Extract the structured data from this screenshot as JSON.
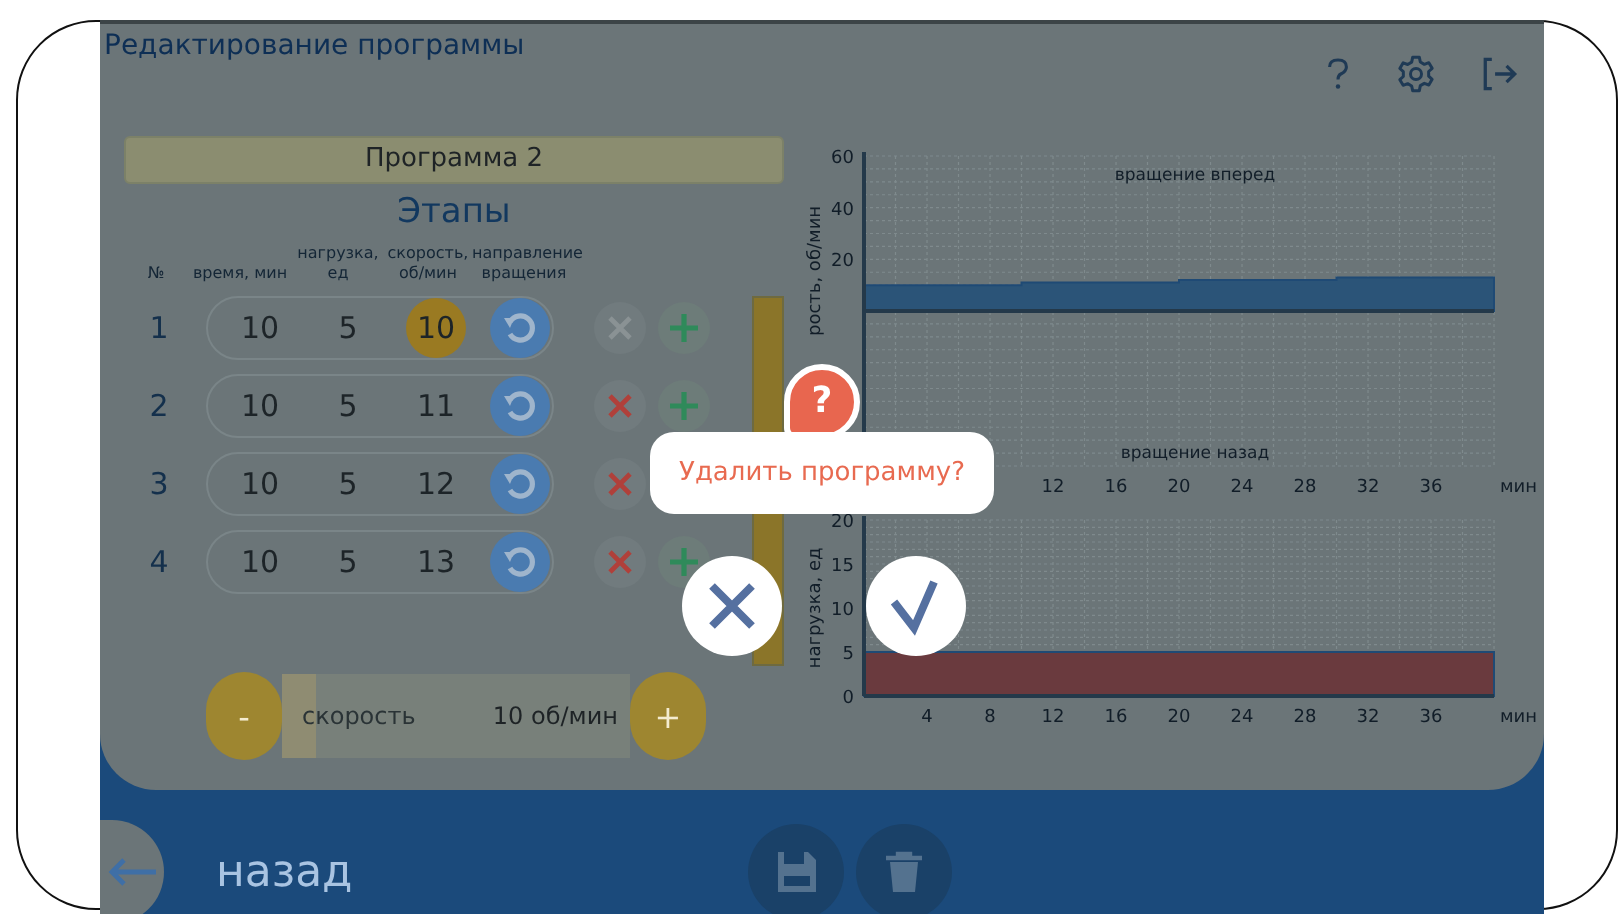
{
  "header": {
    "title": "Редактирование программы"
  },
  "program": {
    "name": "Программа 2"
  },
  "stages": {
    "title": "Этапы",
    "columns": [
      "№",
      "время, мин",
      "нагрузка, ед",
      "скорость, об/мин",
      "направление вращения"
    ],
    "rows": [
      {
        "num": "1",
        "time": "10",
        "load": "5",
        "speed": "10",
        "selected": true,
        "delete_disabled": true
      },
      {
        "num": "2",
        "time": "10",
        "load": "5",
        "speed": "11",
        "selected": false,
        "delete_disabled": false
      },
      {
        "num": "3",
        "time": "10",
        "load": "5",
        "speed": "12",
        "selected": false,
        "delete_disabled": false
      },
      {
        "num": "4",
        "time": "10",
        "load": "5",
        "speed": "13",
        "selected": false,
        "delete_disabled": false
      }
    ]
  },
  "speed_control": {
    "minus": "-",
    "label": "скорость",
    "value": "10 об/мин",
    "plus": "+",
    "level": 0.1
  },
  "charts": [
    {
      "chart_data": {
        "type": "area",
        "grid": true,
        "ylabel": "рость, об/мин",
        "xlabel": "мин",
        "x": [
          0,
          10,
          20,
          30,
          40
        ],
        "series": [
          {
            "color": "#2b5478",
            "values": [
              10,
              11,
              12,
              13,
              13
            ]
          }
        ],
        "xlim": [
          0,
          40
        ],
        "ylim": [
          -60,
          60
        ],
        "xticks": [
          12,
          16,
          20,
          24,
          28,
          32,
          36
        ],
        "yticks": [
          20,
          40,
          60
        ],
        "annotations": [
          "вращение вперед",
          "вращение назад"
        ]
      }
    },
    {
      "chart_data": {
        "type": "area",
        "grid": true,
        "ylabel": "нагрузка, ед",
        "xlabel": "мин",
        "x": [
          0,
          10,
          20,
          30,
          40
        ],
        "series": [
          {
            "color": "#6a3a3e",
            "values": [
              5,
              5,
              5,
              5,
              5
            ]
          }
        ],
        "xlim": [
          0,
          40
        ],
        "ylim": [
          0,
          20
        ],
        "xticks": [
          4,
          8,
          12,
          16,
          20,
          24,
          28,
          32,
          36
        ],
        "yticks": [
          0,
          5,
          10,
          15,
          20
        ]
      }
    }
  ],
  "footer": {
    "back": "назад"
  },
  "dialog": {
    "icon": "?",
    "message": "Удалить программу?"
  }
}
